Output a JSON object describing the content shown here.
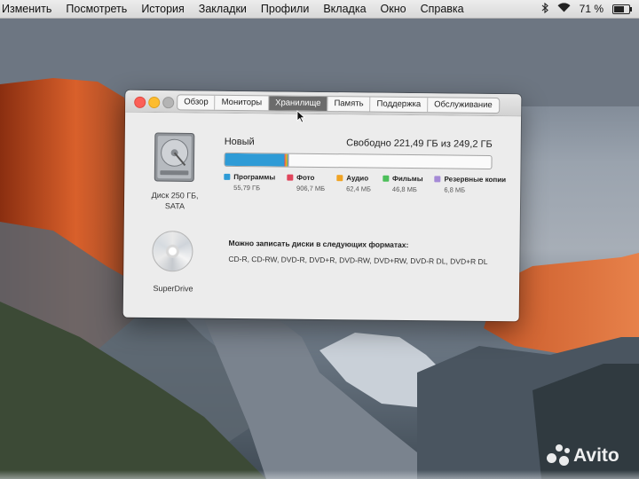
{
  "menubar": {
    "items": [
      "Изменить",
      "Посмотреть",
      "История",
      "Закладки",
      "Профили",
      "Вкладка",
      "Окно",
      "Справка"
    ],
    "battery_percent": "71 %",
    "battery_level": 0.71
  },
  "window": {
    "tabs": [
      {
        "label": "Обзор",
        "active": false
      },
      {
        "label": "Мониторы",
        "active": false
      },
      {
        "label": "Хранилище",
        "active": true
      },
      {
        "label": "Память",
        "active": false
      },
      {
        "label": "Поддержка",
        "active": false
      },
      {
        "label": "Обслуживание",
        "active": false
      }
    ],
    "disk": {
      "label_line1": "Диск 250 ГБ,",
      "label_line2": "SATA",
      "volume_name": "Новый",
      "free_text": "Свободно 221,49 ГБ из 249,2 ГБ",
      "capacity_gb": 249.2,
      "usage": [
        {
          "label": "Программы",
          "size": "55,79 ГБ",
          "gb": 55.79,
          "color": "#2e9bd6"
        },
        {
          "label": "Фото",
          "size": "906,7 МБ",
          "gb": 0.9067,
          "color": "#e0455c"
        },
        {
          "label": "Аудио",
          "size": "62,4 МБ",
          "gb": 0.0624,
          "color": "#f0a425"
        },
        {
          "label": "Фильмы",
          "size": "46,8 МБ",
          "gb": 0.0468,
          "color": "#4cbf5a"
        },
        {
          "label": "Резервные копии",
          "size": "6,8 МБ",
          "gb": 0.0068,
          "color": "#a58ad6"
        }
      ]
    },
    "superdrive": {
      "label": "SuperDrive",
      "formats_heading": "Можно записать диски в следующих форматах:",
      "formats_list": "CD-R, CD-RW, DVD-R, DVD+R, DVD-RW, DVD+RW, DVD-R DL, DVD+R DL"
    }
  },
  "watermark": {
    "text": "Avito"
  },
  "icons": [
    "bluetooth-icon",
    "wifi-icon",
    "battery-icon",
    "hard-disk-icon",
    "cd-icon",
    "cursor-icon"
  ]
}
